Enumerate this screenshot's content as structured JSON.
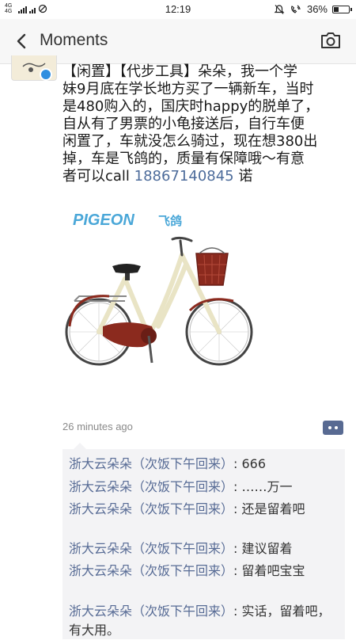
{
  "status_bar": {
    "network": "4G 4G",
    "time": "12:19",
    "battery": "36%",
    "icons": [
      "signal-icon",
      "sim-off-icon",
      "mute-icon",
      "wifi-call-icon",
      "battery-icon"
    ]
  },
  "nav": {
    "title": "Moments",
    "back_icon": "chevron-left-icon",
    "camera_icon": "camera-icon"
  },
  "post": {
    "text_lines": [
      "【闲置】【代步工具】朵朵，我一个学",
      "妹9月底在学长地方买了一辆新车，当时",
      "是480购入的，国庆时happy的脱单了，",
      "自从有了男票的小龟接送后，自行车便",
      "闲置了，车就没怎么骑过，现在想380出",
      "掉，车是飞鸽的，质量有保障哦～有意"
    ],
    "last_line_before": "者可以call ",
    "phone": "18867140845",
    "last_line_after": " 诺",
    "image": {
      "brand": "PIGEON",
      "brand_cn": "飞鸽",
      "brand_color": "#4aa7d8",
      "frame_color": "#e9e4c5",
      "accent_color": "#8b2a1e"
    },
    "timestamp": "26 minutes ago"
  },
  "comments": [
    {
      "name": "浙大云朵朵（次饭下午回来）",
      "text": "666",
      "lines": 1
    },
    {
      "name": "浙大云朵朵（次饭下午回来）",
      "text": "……万一",
      "lines": 1
    },
    {
      "name": "浙大云朵朵（次饭下午回来）",
      "text": "还是留着吧",
      "lines": 2
    },
    {
      "name": "浙大云朵朵（次饭下午回来）",
      "text": "建议留着",
      "lines": 1
    },
    {
      "name": "浙大云朵朵（次饭下午回来）",
      "text": "留着吧宝宝",
      "lines": 2
    },
    {
      "name": "浙大云朵朵（次饭下午回来）",
      "text": "实话，留着吧，有大用。",
      "lines": 2
    }
  ],
  "colors": {
    "link_blue": "#576b95",
    "comment_bg": "#f3f3f5",
    "nav_bg": "#f7f7f7"
  }
}
